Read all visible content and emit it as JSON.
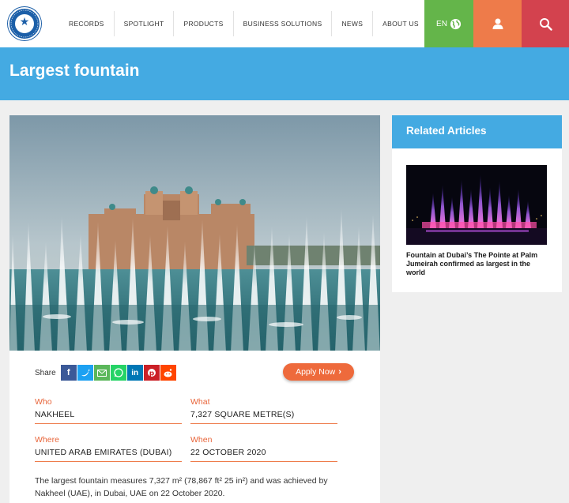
{
  "header": {
    "nav": [
      "RECORDS",
      "SPOTLIGHT",
      "PRODUCTS",
      "BUSINESS SOLUTIONS",
      "NEWS",
      "ABOUT US"
    ],
    "language": "EN",
    "colors": {
      "lang": "#64b54a",
      "user": "#ee7b4a",
      "search": "#d3424e"
    }
  },
  "page": {
    "title": "Largest fountain"
  },
  "share": {
    "label": "Share",
    "networks": [
      "facebook",
      "twitter",
      "email",
      "whatsapp",
      "linkedin",
      "pinterest",
      "reddit"
    ]
  },
  "apply_button": "Apply Now",
  "record": {
    "who_label": "Who",
    "who": "NAKHEEL",
    "what_label": "What",
    "what": "7,327 SQUARE METRE(S)",
    "where_label": "Where",
    "where_country": "UNITED ARAB EMIRATES",
    "where_city": "(DUBAI)",
    "when_label": "When",
    "when": "22 OCTOBER 2020",
    "description": "The largest fountain measures 7,327 m² (78,867 ft² 25 in²) and was achieved by Nakheel (UAE), in Dubai, UAE on 22 October 2020."
  },
  "sidebar": {
    "title": "Related Articles",
    "articles": [
      {
        "title": "Fountain at Dubai’s The Pointe at Palm Jumeirah confirmed as largest in the world"
      }
    ]
  }
}
